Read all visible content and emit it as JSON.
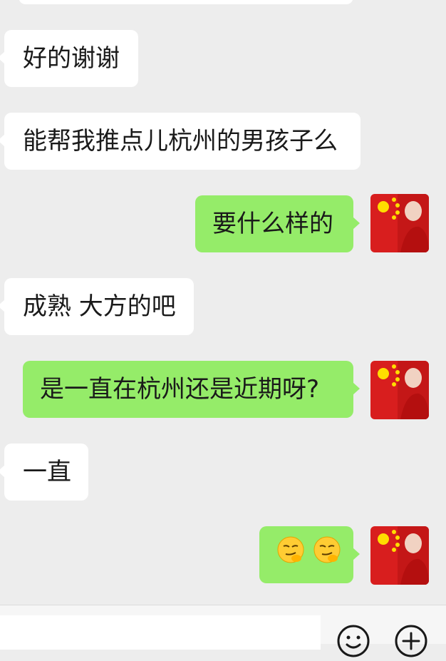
{
  "messages": [
    {
      "side": "in",
      "text": "好的谢谢"
    },
    {
      "side": "in",
      "text": "能帮我推点儿杭州的男孩子么"
    },
    {
      "side": "out",
      "text": "要什么样的"
    },
    {
      "side": "in",
      "text": "成熟 大方的吧"
    },
    {
      "side": "out",
      "text": "是一直在杭州还是近期呀?"
    },
    {
      "side": "in",
      "text": "一直"
    },
    {
      "side": "out",
      "text": "",
      "emoji": [
        "smirk-hand-emoji",
        "smirk-hand-emoji"
      ]
    }
  ],
  "input": {
    "value": "",
    "placeholder": ""
  },
  "colors": {
    "background": "#ededed",
    "incoming_bubble": "#ffffff",
    "outgoing_bubble": "#95ec69",
    "avatar_red": "#d81e1e",
    "avatar_star": "#ffde00"
  },
  "icons": [
    "emoji-icon",
    "plus-icon",
    "chn-flag-avatar-icon"
  ]
}
